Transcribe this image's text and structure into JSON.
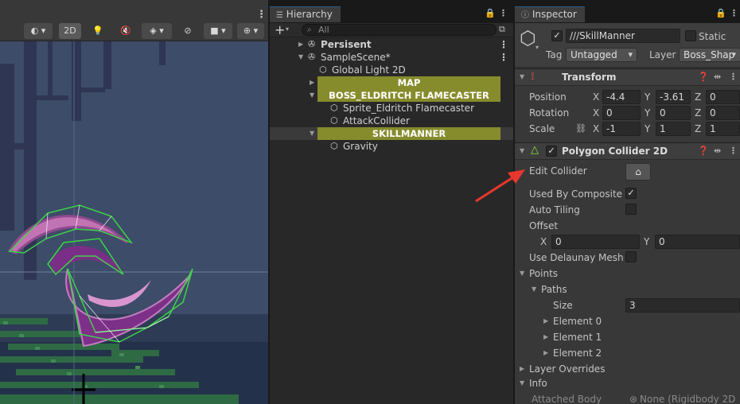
{
  "scene": {
    "toolbar": {
      "mode_2d_label": "2D"
    }
  },
  "hierarchy": {
    "tab_label": "Hierarchy",
    "search_placeholder": "All",
    "add_label": "+",
    "rows": [
      {
        "label": "Persisent"
      },
      {
        "label": "SampleScene*"
      },
      {
        "label": "Global Light 2D"
      },
      {
        "label": "MAP"
      },
      {
        "label": "BOSS_ELDRITCH FLAMECASTER"
      },
      {
        "label": "Sprite_Eldritch Flamecaster"
      },
      {
        "label": "AttackCollider"
      },
      {
        "label": "SKILLMANNER"
      },
      {
        "label": "Gravity"
      }
    ]
  },
  "inspector": {
    "tab_label": "Inspector",
    "object_name": "///SkillManner",
    "static_label": "Static",
    "tag_label": "Tag",
    "tag_value": "Untagged",
    "layer_label": "Layer",
    "layer_value": "Boss_Shap",
    "transform": {
      "title": "Transform",
      "position_label": "Position",
      "rotation_label": "Rotation",
      "scale_label": "Scale",
      "x_label": "X",
      "y_label": "Y",
      "z_label": "Z",
      "position": {
        "x": "-4.4",
        "y": "-3.61",
        "z": "0"
      },
      "rotation": {
        "x": "0",
        "y": "0",
        "z": "0"
      },
      "scale": {
        "x": "-1",
        "y": "1",
        "z": "1"
      }
    },
    "collider": {
      "title": "Polygon Collider 2D",
      "edit_collider_label": "Edit Collider",
      "used_by_composite_label": "Used By Composite",
      "auto_tiling_label": "Auto Tiling",
      "offset_label": "Offset",
      "offset_x_label": "X",
      "offset_y_label": "Y",
      "offset_x": "0",
      "offset_y": "0",
      "use_delaunay_label": "Use Delaunay Mesh",
      "points_label": "Points",
      "paths_label": "Paths",
      "size_label": "Size",
      "size_value": "3",
      "elements": [
        "Element 0",
        "Element 1",
        "Element 2"
      ],
      "layer_overrides_label": "Layer Overrides",
      "info_label": "Info",
      "attached_body_label": "Attached Body",
      "attached_body_value": "None (Rigidbody 2D"
    }
  },
  "colors": {
    "highlight": "#868b2c",
    "annotation_arrow": "#e8372e",
    "collider_outline": "#40d040",
    "sprite_purple": "#8a3a8e",
    "sprite_pink": "#e38ac9"
  }
}
